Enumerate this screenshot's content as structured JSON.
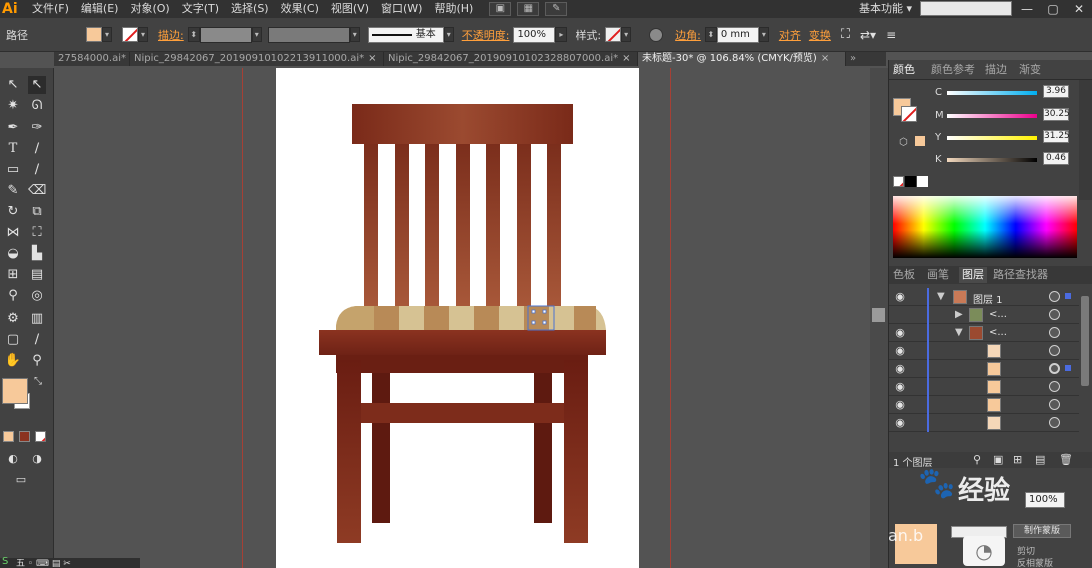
{
  "app": {
    "logo": "Ai"
  },
  "menu": [
    "文件(F)",
    "编辑(E)",
    "对象(O)",
    "文字(T)",
    "选择(S)",
    "效果(C)",
    "视图(V)",
    "窗口(W)",
    "帮助(H)"
  ],
  "workspace_label": "基本功能",
  "control_bar": {
    "selection_type": "路径",
    "stroke_link": "描边:",
    "stroke_profile": "基本",
    "opacity_link": "不透明度:",
    "opacity_value": "100%",
    "style_label": "样式:",
    "corner_link": "边角:",
    "corner_value": "0 mm",
    "align_link": "对齐",
    "transform_link": "变换"
  },
  "tabs": [
    {
      "label": "27584000.ai*",
      "active": false
    },
    {
      "label": "Nipic_29842067_20190910102213911000.ai*",
      "active": false
    },
    {
      "label": "Nipic_29842067_20190910102328807000.ai*",
      "active": false
    },
    {
      "label": "未标题-30* @ 106.84% (CMYK/预览)",
      "active": true
    }
  ],
  "color_panel": {
    "tabs": [
      "颜色",
      "颜色参考",
      "描边",
      "渐变"
    ],
    "channels": [
      {
        "label": "C",
        "value": "3.96"
      },
      {
        "label": "M",
        "value": "30.25"
      },
      {
        "label": "Y",
        "value": "31.25"
      },
      {
        "label": "K",
        "value": "0.46"
      }
    ]
  },
  "layers_panel": {
    "tabs": [
      "色板",
      "画笔",
      "图层",
      "路径查找器"
    ],
    "rows": [
      {
        "name": "图层 1",
        "level": 0
      },
      {
        "name": "<...",
        "level": 1
      },
      {
        "name": "<...",
        "level": 1
      },
      {
        "name": "",
        "level": 2
      },
      {
        "name": "",
        "level": 2
      },
      {
        "name": "",
        "level": 2
      },
      {
        "name": "",
        "level": 2
      },
      {
        "name": "",
        "level": 2
      }
    ],
    "footer_count": "1 个图层"
  },
  "bottom_panel": {
    "opacity_value": "100%",
    "button_label": "制作蒙版",
    "option1": "剪切",
    "option2": "反相蒙版"
  },
  "watermark": {
    "text": "经验",
    "url_text": "an.b"
  },
  "colors": {
    "fill": "#f7c99a",
    "chair_dark": "#6e2014",
    "chair_mid": "#8b3320",
    "seat_light": "#d9c49a",
    "seat_dark": "#b58a55"
  }
}
